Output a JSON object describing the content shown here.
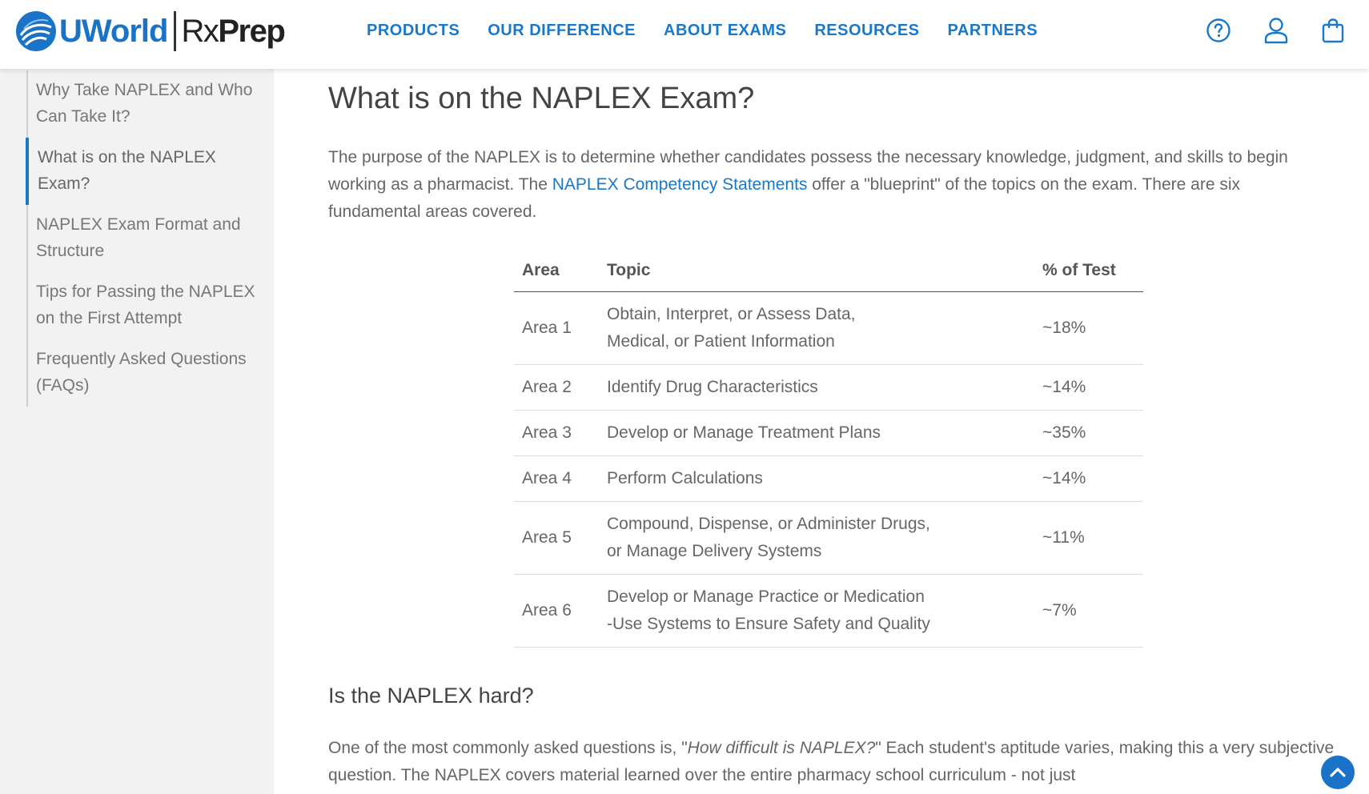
{
  "header": {
    "logo": {
      "brand": "UWorld",
      "product_rx": "Rx",
      "product_prep": "Prep"
    },
    "nav": [
      "PRODUCTS",
      "OUR DIFFERENCE",
      "ABOUT EXAMS",
      "RESOURCES",
      "PARTNERS"
    ],
    "icons": [
      "help-circle-icon",
      "user-icon",
      "shopping-bag-icon"
    ]
  },
  "sidebar": {
    "items": [
      {
        "label": "Why Take NAPLEX and Who Can Take It?",
        "active": false
      },
      {
        "label": "What is on the NAPLEX Exam?",
        "active": true
      },
      {
        "label": "NAPLEX Exam Format and Structure",
        "active": false
      },
      {
        "label": "Tips for Passing the NAPLEX on the First Attempt",
        "active": false
      },
      {
        "label": "Frequently Asked Questions (FAQs)",
        "active": false
      }
    ]
  },
  "main": {
    "title": "What is on the NAPLEX Exam?",
    "intro_before": "The purpose of the NAPLEX is to determine whether candidates possess the necessary knowledge, judgment, and skills to begin working as a pharmacist. The ",
    "intro_link": "NAPLEX Competency Statements",
    "intro_after": " offer a \"blueprint\" of the topics on the exam. There are six fundamental areas covered.",
    "table": {
      "headers": [
        "Area",
        "Topic",
        "% of Test"
      ],
      "rows": [
        {
          "area": "Area 1",
          "topic_line1": "Obtain, Interpret, or Assess Data,",
          "topic_line2": "Medical, or Patient Information",
          "percent": "~18%"
        },
        {
          "area": "Area 2",
          "topic_line1": "Identify Drug Characteristics",
          "topic_line2": "",
          "percent": "~14%"
        },
        {
          "area": "Area 3",
          "topic_line1": "Develop or Manage Treatment Plans",
          "topic_line2": "",
          "percent": "~35%"
        },
        {
          "area": "Area 4",
          "topic_line1": "Perform Calculations",
          "topic_line2": "",
          "percent": "~14%"
        },
        {
          "area": "Area 5",
          "topic_line1": "Compound, Dispense, or Administer Drugs,",
          "topic_line2": "or Manage Delivery Systems",
          "percent": "~11%"
        },
        {
          "area": "Area 6",
          "topic_line1": "Develop or Manage Practice or Medication",
          "topic_line2": "-Use Systems to Ensure Safety and Quality",
          "percent": "~7%"
        }
      ]
    },
    "subheading": "Is the NAPLEX hard?",
    "para2_before": "One of the most commonly asked questions is, \"",
    "para2_italic": "How difficult is NAPLEX?",
    "para2_after": "\" Each student's aptitude varies, making this a very subjective question. The NAPLEX covers material learned over the entire pharmacy school curriculum - not just"
  },
  "colors": {
    "brand_blue": "#1a73c7",
    "nav_blue": "#1a78c8",
    "sidebar_bg": "#f2f2f2"
  }
}
